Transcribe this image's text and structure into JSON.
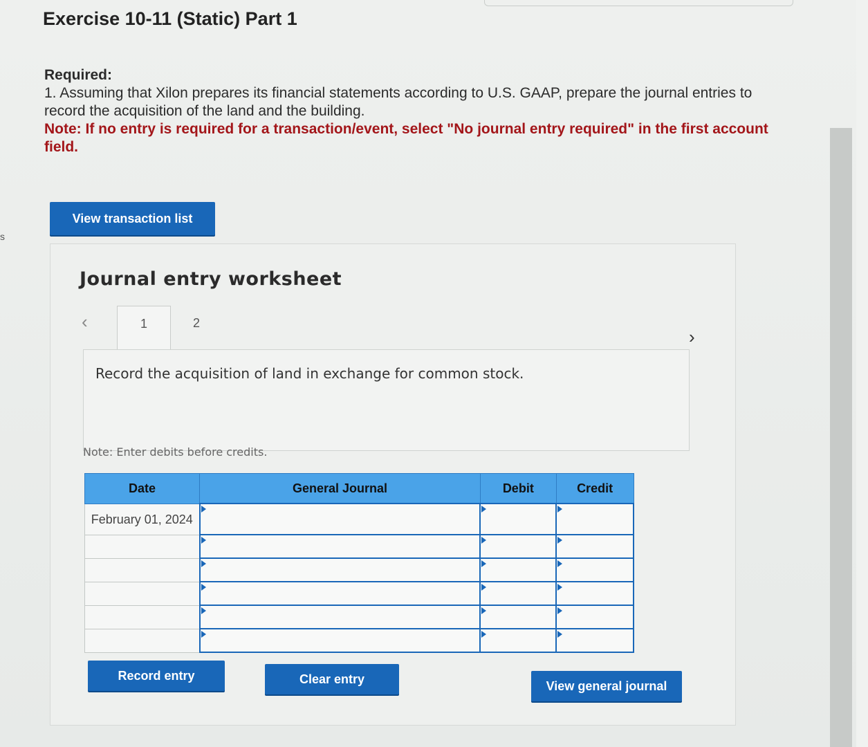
{
  "exercise_title": "Exercise 10-11 (Static) Part 1",
  "required": {
    "label": "Required:",
    "text": "1. Assuming that Xilon prepares its financial statements according to U.S. GAAP, prepare the journal entries to record the acquisition of the land and the building.",
    "note": "Note: If no entry is required for a transaction/event, select \"No journal entry required\" in the first account field."
  },
  "buttons": {
    "view_transaction_list": "View transaction list",
    "record_entry": "Record entry",
    "clear_entry": "Clear entry",
    "view_general_journal": "View general journal"
  },
  "worksheet": {
    "title": "Journal entry worksheet",
    "tabs": [
      "1",
      "2"
    ],
    "prev_icon": "chevron-left",
    "next_icon": "chevron-right",
    "description": "Record the acquisition of land in exchange for common stock.",
    "note": "Note: Enter debits before credits."
  },
  "journal_table": {
    "headers": [
      "Date",
      "General Journal",
      "Debit",
      "Credit"
    ],
    "rows": [
      {
        "date": "February 01, 2024",
        "account": "",
        "debit": "",
        "credit": ""
      },
      {
        "date": "",
        "account": "",
        "debit": "",
        "credit": ""
      },
      {
        "date": "",
        "account": "",
        "debit": "",
        "credit": ""
      },
      {
        "date": "",
        "account": "",
        "debit": "",
        "credit": ""
      },
      {
        "date": "",
        "account": "",
        "debit": "",
        "credit": ""
      },
      {
        "date": "",
        "account": "",
        "debit": "",
        "credit": ""
      }
    ]
  },
  "colors": {
    "accent": "#1967b8",
    "header_blue": "#4aa3e8",
    "note_red": "#a3161a"
  },
  "side_mark": "s"
}
